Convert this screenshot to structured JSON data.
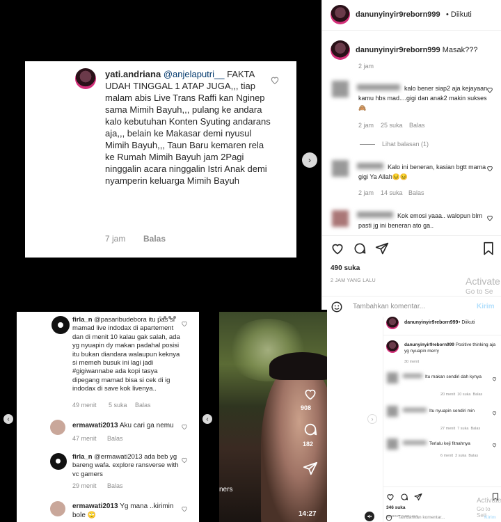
{
  "top_post": {
    "comment_user": "yati.andriana",
    "comment_mention": "@anjelaputri__",
    "comment_text": "FAKTA UDAH TINGGAL 1 ATAP JUGA,,, tiap malam abis Live Trans Raffi kan Nginep sama Mimih Bayuh,,, pulang ke andara kalo kebutuhan Konten Syuting andarans aja,,, belain ke Makasar demi nyusul Mimih Bayuh,,, Taun Baru kemaren rela ke Rumah Mimih Bayuh jam 2Pagi ninggalin acara ninggalin Istri Anak demi nyamperin keluarga Mimih Bayuh",
    "time": "7 jam",
    "reply": "Balas"
  },
  "panel_top": {
    "username": "danunyinyir9reborn999",
    "follow": "Diikuti",
    "caption": "Masak???",
    "caption_time": "2 jam",
    "comments": [
      {
        "text": "kalo bener siap2 aja kejayaan kamu hbs mad....gigi dan anak2 makin sukses 🙈",
        "time": "2 jam",
        "likes": "25 suka",
        "reply": "Balas"
      },
      {
        "text": "Kalo ini beneran, kasian bgtt mama gigi Ya Allah😣😣",
        "time": "2 jam",
        "likes": "14 suka",
        "reply": "Balas"
      },
      {
        "text": "Kok emosi yaaa.. walopun blm pasti jg ini beneran ato ga..",
        "time": "",
        "likes": "",
        "reply": ""
      }
    ],
    "view_replies": "Lihat balasan (1)",
    "likes": "490 suka",
    "posted": "2 JAM YANG LALU",
    "add_comment": "Tambahkan komentar...",
    "send": "Kirim",
    "activate": "Activate",
    "activate_sub": "Go to Se"
  },
  "bottom_left": {
    "comments": [
      {
        "user": "firla_n",
        "text": "@pasaribudebora itu pas si mamad live indodax di apartement dan di menit 10 kalau gak salah, ada yg nyuapin dy makan padahal posisi itu bukan diandara walaupun keknya si memeh busuk ini lagi jadi #gigiwannabe ada kopi tasya dipegang mamad bisa si cek di ig indodax di save kok livenya..",
        "time": "49 menit",
        "likes": "5 suka",
        "reply": "Balas"
      },
      {
        "user": "ermawati2013",
        "text": "Aku cari ga nemu",
        "time": "47 menit",
        "likes": "",
        "reply": "Balas"
      },
      {
        "user": "firla_n",
        "text": "@ermawati2013 ada beb yg bareng wafa. explore ransverse with vc gamers",
        "time": "29 menit",
        "likes": "",
        "reply": "Balas"
      },
      {
        "user": "ermawati2013",
        "text": "Yg mana ..kirimin bole 🙄",
        "time": "",
        "likes": "",
        "reply": ""
      }
    ]
  },
  "video": {
    "likes": "908",
    "comments": "182",
    "ticker": "ners",
    "timestamp": "14:27"
  },
  "panel_bottom": {
    "username": "danunyinyir9reborn999",
    "follow": "Diikuti",
    "caption": "Positive thinking aja yg nyuapin merry",
    "caption_time": "30 menit",
    "comments": [
      {
        "text": "Itu makan sendiri dah kynya",
        "time": "20 menit",
        "likes": "10 suka",
        "reply": "Balas"
      },
      {
        "text": "Itu nyuapin sendiri min",
        "time": "27 menit",
        "likes": "7 suka",
        "reply": "Balas"
      },
      {
        "text": "Terlalu keji fitnahnya",
        "time": "6 menit",
        "likes": "2 suka",
        "reply": "Balas"
      }
    ],
    "likes": "346 suka",
    "posted": "30 MENIT YANG LALU",
    "add_comment": "Tambahkan komentar...",
    "send": "Kirim",
    "activate": "Activate",
    "activate_sub": "Go to Sett"
  }
}
